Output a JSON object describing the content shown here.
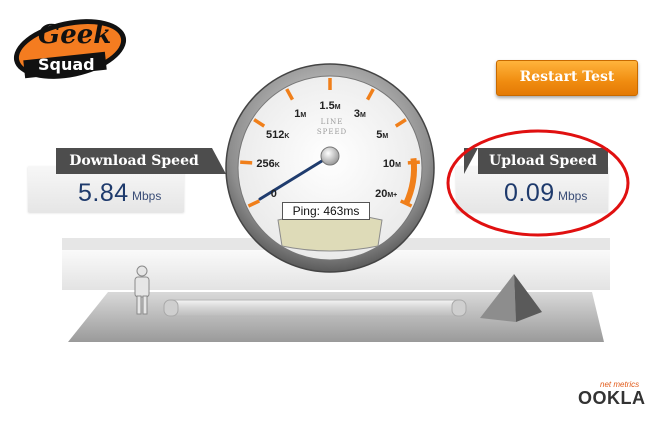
{
  "logo": {
    "line1": "Geek",
    "line2": "Squad"
  },
  "restart_button": {
    "label": "Restart Test"
  },
  "download": {
    "title": "Download Speed",
    "value": "5.84",
    "unit": "Mbps"
  },
  "upload": {
    "title": "Upload Speed",
    "value": "0.09",
    "unit": "Mbps"
  },
  "gauge": {
    "brand_line1": "LINE",
    "brand_line2": "SPEED",
    "ticks": [
      {
        "value": "0",
        "suffix": ""
      },
      {
        "value": "256",
        "suffix": "K"
      },
      {
        "value": "512",
        "suffix": "K"
      },
      {
        "value": "1",
        "suffix": "M"
      },
      {
        "value": "1.5",
        "suffix": "M"
      },
      {
        "value": "3",
        "suffix": "M"
      },
      {
        "value": "5",
        "suffix": "M"
      },
      {
        "value": "10",
        "suffix": "M"
      },
      {
        "value": "20",
        "suffix": "M+"
      }
    ],
    "ping": "Ping: 463ms",
    "accent_color": "#f07f1a"
  },
  "brand_footer": {
    "tag": "net metrics",
    "name": "OOKLA"
  },
  "colors": {
    "orange": "#f08c10",
    "dark_tab": "#4d4d4d",
    "value_blue": "#1e3a6c",
    "annotation_red": "#e01010"
  }
}
